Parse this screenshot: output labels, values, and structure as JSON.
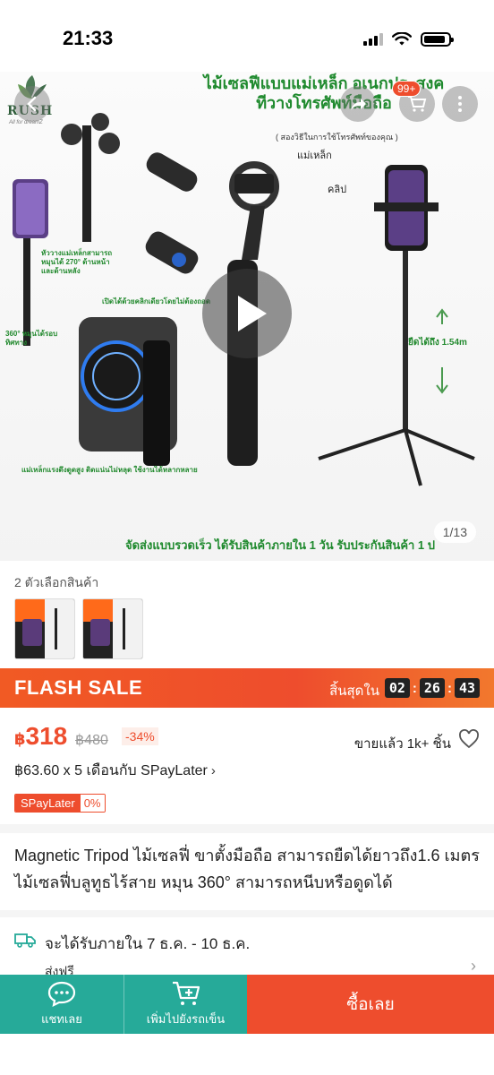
{
  "status_bar": {
    "time": "21:33"
  },
  "hero": {
    "brand_name": "RUSH",
    "brand_tagline": "All for dreamZ",
    "title_line1": "ไม้เซลฟีแบบแม่เหล็ก อเนกประสงค",
    "title_line2": "ทีวางโทรศัพท์มือถือ",
    "subtitle": "( สองวิธีในการใช้โทรศัพท์ของคุณ )",
    "label_magnet": "แม่เหล็ก",
    "label_clip": "คลิป",
    "note_rotate_270": "หัววางแม่เหล็กสามารถหมุนได้ 270° ด้านหน้าและด้านหลัง",
    "note_rotate_360": "360° หมุนได้รอบทิศทาง",
    "note_open_clip": "เปิดได้ด้วยคลิกเดียวโดยไม่ต้องถอด",
    "note_magnet_use": "แม่เหล็กแรงดึงดูดสูง ติดแน่นไม่หลุด ใช้งานได้หลากหลาย",
    "note_extend": "ยืดได้ถึง 1.54m",
    "bottom_banner": "จัดส่งแบบรวดเร็ว ได้รับสินค้าภายใน 1 วัน รับประกันสินค้า 1 ป",
    "page_counter": "1/13",
    "cart_badge": "99+"
  },
  "variants": {
    "label": "2 ตัวเลือกสินค้า"
  },
  "flash_sale": {
    "title": "FLASH SALE",
    "ends_in_label": "สิ้นสุดใน",
    "hours": "02",
    "minutes": "26",
    "seconds": "43"
  },
  "price": {
    "currency": "฿",
    "current": "318",
    "original": "฿480",
    "discount": "-34%",
    "sold": "ขายแล้ว 1k+ ชิ้น",
    "installment": "฿63.60 x 5 เดือนกับ SPayLater",
    "spay_label": "SPayLater",
    "spay_rate": "0%"
  },
  "product": {
    "title": "Magnetic Tripod ไม้เซลฟี่ ขาตั้งมือถือ สามารถยืดได้ยาวถึง1.6 เมตร ไม้เซลฟี่บลูทูธไร้สาย หมุน 360° สามารถหนีบหรือดูดได้"
  },
  "shipping": {
    "estimate": "จะได้รับภายใน 7 ธ.ค. - 10 ธ.ค.",
    "free_shipping": "ส่งฟรี"
  },
  "bottom_bar": {
    "chat_label": "แชทเลย",
    "add_to_cart_label": "เพิ่มไปยังรถเข็น",
    "buy_now_label": "ซื้อเลย"
  },
  "colors": {
    "shopee_orange": "#ee4d2d",
    "teal": "#26aa99",
    "title_green": "#1f8a2e"
  }
}
